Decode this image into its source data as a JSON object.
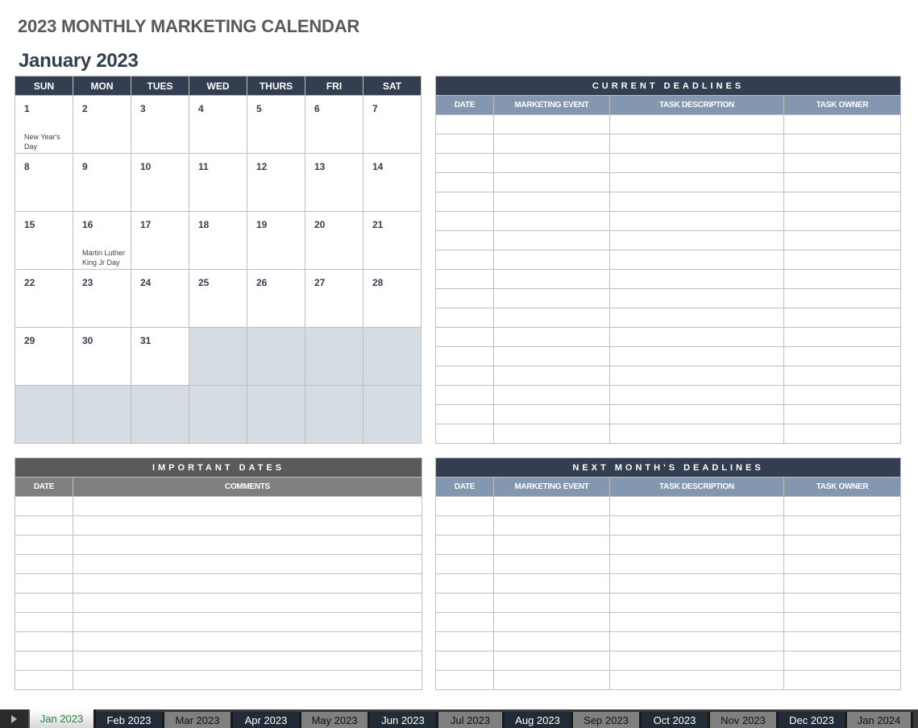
{
  "page_title": "2023 MONTHLY MARKETING CALENDAR",
  "month_title": "January 2023",
  "calendar": {
    "weekdays": [
      "SUN",
      "MON",
      "TUES",
      "WED",
      "THURS",
      "FRI",
      "SAT"
    ],
    "weeks": [
      [
        {
          "day": "1",
          "note": "New Year's Day"
        },
        {
          "day": "2"
        },
        {
          "day": "3"
        },
        {
          "day": "4"
        },
        {
          "day": "5"
        },
        {
          "day": "6"
        },
        {
          "day": "7"
        }
      ],
      [
        {
          "day": "8"
        },
        {
          "day": "9"
        },
        {
          "day": "10"
        },
        {
          "day": "11"
        },
        {
          "day": "12"
        },
        {
          "day": "13"
        },
        {
          "day": "14"
        }
      ],
      [
        {
          "day": "15"
        },
        {
          "day": "16",
          "note": "Martin Luther King Jr Day"
        },
        {
          "day": "17"
        },
        {
          "day": "18"
        },
        {
          "day": "19"
        },
        {
          "day": "20"
        },
        {
          "day": "21"
        }
      ],
      [
        {
          "day": "22"
        },
        {
          "day": "23"
        },
        {
          "day": "24"
        },
        {
          "day": "25"
        },
        {
          "day": "26"
        },
        {
          "day": "27"
        },
        {
          "day": "28"
        }
      ],
      [
        {
          "day": "29"
        },
        {
          "day": "30"
        },
        {
          "day": "31"
        },
        {
          "day": ""
        },
        {
          "day": ""
        },
        {
          "day": ""
        },
        {
          "day": ""
        }
      ],
      [
        {
          "day": ""
        },
        {
          "day": ""
        },
        {
          "day": ""
        },
        {
          "day": ""
        },
        {
          "day": ""
        },
        {
          "day": ""
        },
        {
          "day": ""
        }
      ]
    ]
  },
  "current_deadlines": {
    "title": "CURRENT DEADLINES",
    "columns": [
      "DATE",
      "MARKETING EVENT",
      "TASK DESCRIPTION",
      "TASK OWNER"
    ],
    "row_count": 17
  },
  "important_dates": {
    "title": "IMPORTANT DATES",
    "columns": [
      "DATE",
      "COMMENTS"
    ],
    "row_count": 10
  },
  "next_month_deadlines": {
    "title": "NEXT MONTH'S DEADLINES",
    "columns": [
      "DATE",
      "MARKETING EVENT",
      "TASK DESCRIPTION",
      "TASK OWNER"
    ],
    "row_count": 10
  },
  "sheet_tabs": [
    {
      "label": "Jan 2023",
      "style": "active"
    },
    {
      "label": "Feb 2023",
      "style": "dark"
    },
    {
      "label": "Mar 2023",
      "style": "gray"
    },
    {
      "label": "Apr 2023",
      "style": "dark"
    },
    {
      "label": "May 2023",
      "style": "gray"
    },
    {
      "label": "Jun 2023",
      "style": "dark"
    },
    {
      "label": "Jul 2023",
      "style": "gray"
    },
    {
      "label": "Aug 2023",
      "style": "dark"
    },
    {
      "label": "Sep 2023",
      "style": "gray"
    },
    {
      "label": "Oct 2023",
      "style": "dark"
    },
    {
      "label": "Nov 2023",
      "style": "gray"
    },
    {
      "label": "Dec 2023",
      "style": "dark"
    },
    {
      "label": "Jan 2024",
      "style": "gray"
    }
  ],
  "colors": {
    "header_navy": "#333F50",
    "subheader_blue": "#8497B0",
    "empty_cell": "#D6DCE4",
    "important_banner": "#595959",
    "important_subheader": "#808080",
    "active_tab_text": "#1E8A3C"
  }
}
